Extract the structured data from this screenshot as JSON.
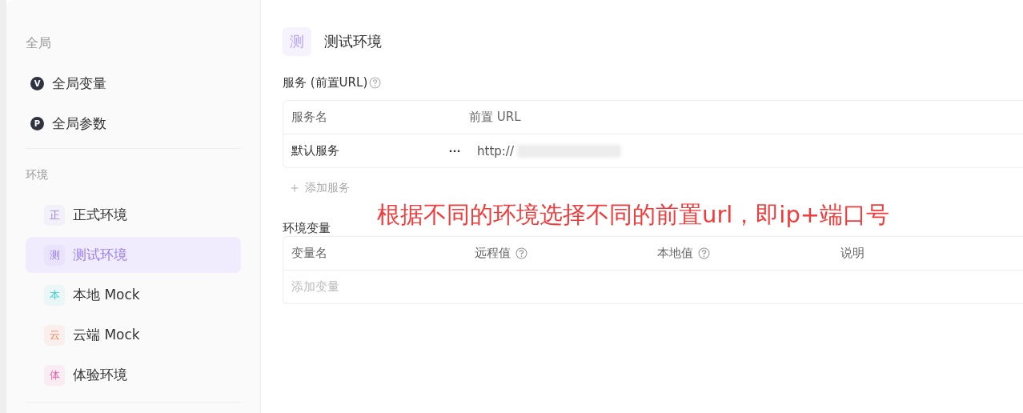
{
  "sidebar": {
    "global_heading": "全局",
    "global_items": [
      {
        "badge": "V",
        "label": "全局变量"
      },
      {
        "badge": "P",
        "label": "全局参数"
      }
    ],
    "env_heading": "环境",
    "environments": [
      {
        "badge": "正",
        "label": "正式环境",
        "color": "#9b7ff0",
        "selected": false
      },
      {
        "badge": "测",
        "label": "测试环境",
        "color": "#9b7ff0",
        "selected": true
      },
      {
        "badge": "本",
        "label": "本地 Mock",
        "color": "#3ccfcf",
        "selected": false
      },
      {
        "badge": "云",
        "label": "云端 Mock",
        "color": "#f0825a",
        "selected": false
      },
      {
        "badge": "体",
        "label": "体验环境",
        "color": "#ec5fa8",
        "selected": false
      }
    ]
  },
  "main": {
    "badge": "测",
    "title": "测试环境",
    "services": {
      "heading": "服务 (前置URL)",
      "columns": [
        "服务名",
        "前置 URL"
      ],
      "rows": [
        {
          "name": "默认服务",
          "more": "···",
          "url": "http://"
        }
      ],
      "add": "添加服务"
    },
    "variables": {
      "heading": "环境变量",
      "columns": [
        {
          "label": "变量名",
          "help": false
        },
        {
          "label": "远程值",
          "help": true
        },
        {
          "label": "本地值",
          "help": true
        },
        {
          "label": "说明",
          "help": false
        }
      ],
      "placeholder": "添加变量"
    }
  },
  "annotation": "根据不同的环境选择不同的前置url，即ip+端口号"
}
